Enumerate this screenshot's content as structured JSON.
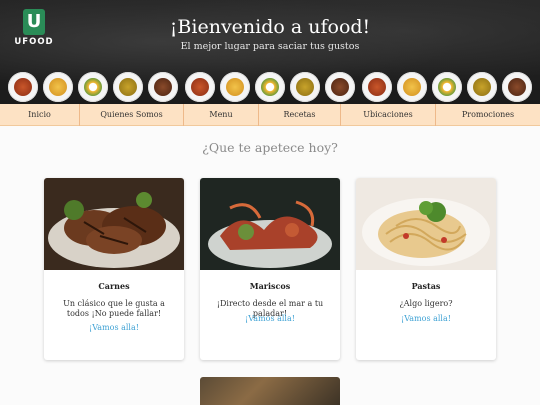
{
  "brand": {
    "logo_letter": "U",
    "logo_text": "UFOOD",
    "color": "#2a8c57"
  },
  "hero": {
    "title": "¡Bienvenido a ufood!",
    "subtitle": "El mejor lugar para saciar tus gustos"
  },
  "nav": {
    "items": [
      {
        "label": "Inicio"
      },
      {
        "label": "Quienes Somos"
      },
      {
        "label": "Menu"
      },
      {
        "label": "Recetas"
      },
      {
        "label": "Ubicaciones"
      },
      {
        "label": "Promociones"
      }
    ],
    "background": "#fde2c4"
  },
  "section": {
    "title": "¿Que te apetece hoy?"
  },
  "cards": [
    {
      "title": "Carnes",
      "description": "Un clásico que le gusta a todos ¡No puede fallar!",
      "link": "¡Vamos alla!"
    },
    {
      "title": "Mariscos",
      "description": "¡Directo desde el mar a tu paladar!",
      "link": "¡Vamos alla!"
    },
    {
      "title": "Pastas",
      "description": "¿Algo ligero?",
      "link": "¡Vamos alla!"
    }
  ],
  "colors": {
    "link": "#3fa2d4",
    "accent": "#2a8c57"
  }
}
